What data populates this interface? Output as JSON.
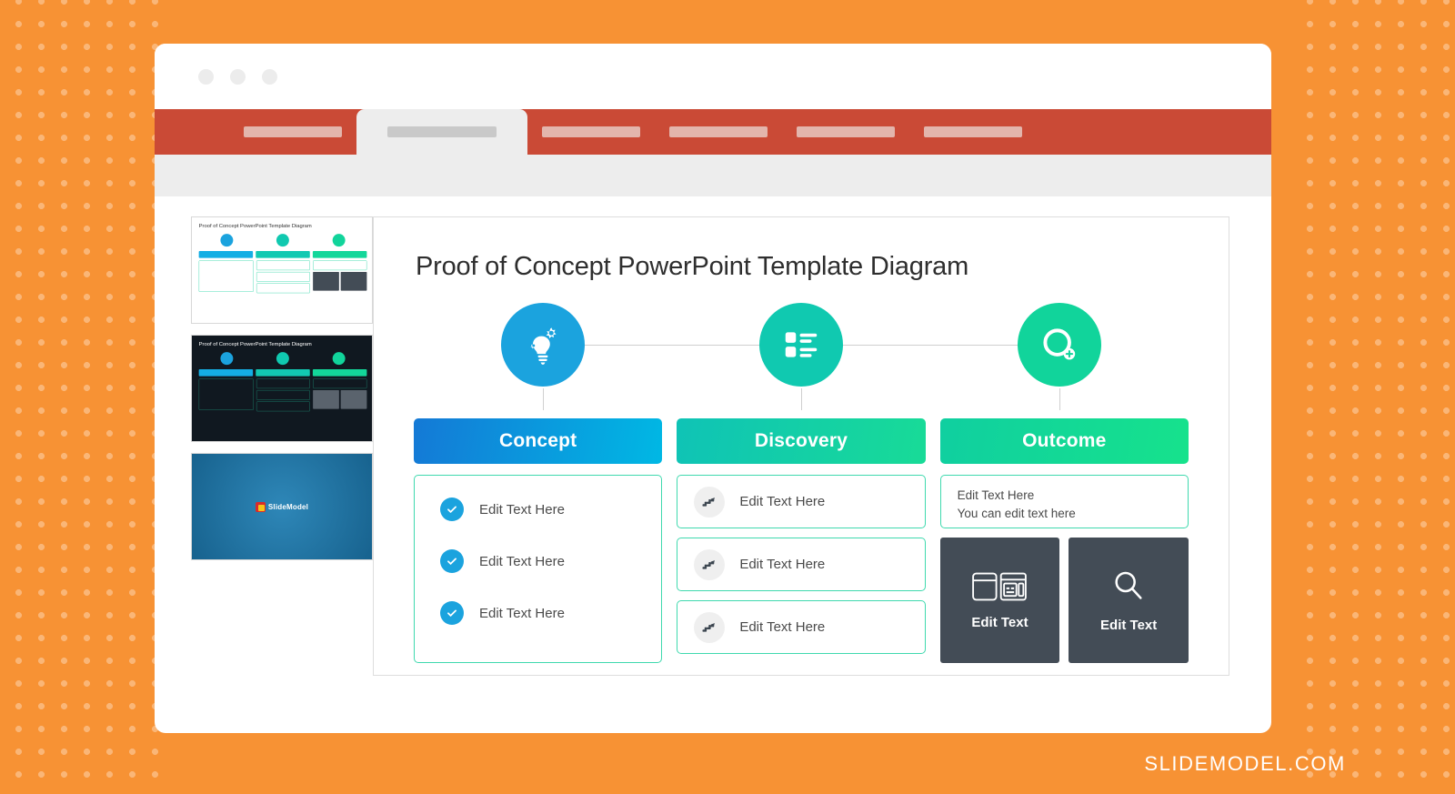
{
  "page": {
    "background_color": "#F79234",
    "footer_text": "SLIDEMODEL.COM"
  },
  "browser": {
    "window_controls": [
      "close-dot",
      "minimize-dot",
      "maximize-dot"
    ],
    "tabs": [
      {
        "name": "tab-1",
        "label": "",
        "active": false
      },
      {
        "name": "tab-2",
        "label": "",
        "active": true
      },
      {
        "name": "tab-3",
        "label": "",
        "active": false
      },
      {
        "name": "tab-4",
        "label": "",
        "active": false
      },
      {
        "name": "tab-5",
        "label": "",
        "active": false
      },
      {
        "name": "tab-6",
        "label": "",
        "active": false
      }
    ],
    "tabstrip_color": "#CA4A36",
    "toolbar_color": "#EDEDED"
  },
  "thumbnails": [
    {
      "name": "slide-thumbnail-1",
      "variant": "light",
      "title": "Proof of Concept PowerPoint Template Diagram"
    },
    {
      "name": "slide-thumbnail-2",
      "variant": "dark",
      "title": "Proof of Concept PowerPoint Template Diagram"
    },
    {
      "name": "slide-thumbnail-3",
      "variant": "cover",
      "title": "SlideModel"
    }
  ],
  "logo": {
    "text": "SlideModel"
  },
  "slide": {
    "title": "Proof of Concept PowerPoint Template Diagram",
    "columns": [
      {
        "key": "concept",
        "header": "Concept",
        "icon": "lightbulb-gears-icon",
        "circle_color": "#1BA3DE",
        "header_gradient_from": "#1479D6",
        "header_gradient_to": "#00B3E6",
        "items": [
          {
            "label": "Edit Text Here",
            "icon": "check-circle-icon"
          },
          {
            "label": "Edit Text Here",
            "icon": "check-circle-icon"
          },
          {
            "label": "Edit Text Here",
            "icon": "check-circle-icon"
          }
        ]
      },
      {
        "key": "discovery",
        "header": "Discovery",
        "icon": "checklist-icon",
        "circle_color": "#10C9B0",
        "header_gradient_from": "#0FC3B6",
        "header_gradient_to": "#17D99A",
        "items": [
          {
            "label": "Edit Text Here",
            "icon": "stairs-arrow-icon"
          },
          {
            "label": "Edit Text Here",
            "icon": "stairs-arrow-icon"
          },
          {
            "label": "Edit Text Here",
            "icon": "stairs-arrow-icon"
          }
        ]
      },
      {
        "key": "outcome",
        "header": "Outcome",
        "icon": "magnifier-plus-icon",
        "circle_color": "#11D49B",
        "header_gradient_from": "#10CFA0",
        "header_gradient_to": "#16E08E",
        "text_box": {
          "line1": "Edit Text Here",
          "line2": "You can edit text here"
        },
        "cards": [
          {
            "label": "Edit Text",
            "icon": "layout-windows-icon"
          },
          {
            "label": "Edit Text",
            "icon": "magnifier-icon"
          }
        ]
      }
    ],
    "accent_border_color": "#3FD9AE",
    "dark_card_color": "#434C56"
  }
}
